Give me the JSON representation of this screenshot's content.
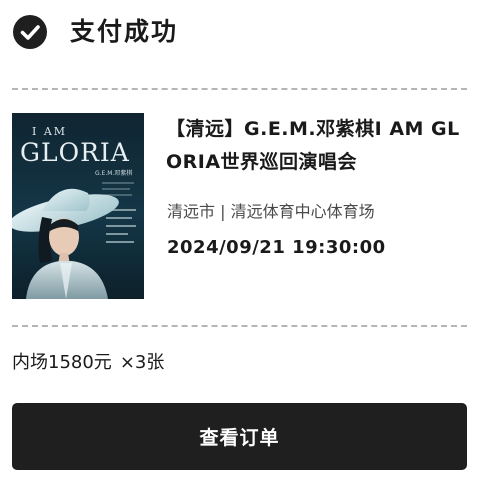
{
  "header": {
    "title": "支付成功",
    "status_icon": "check-circle-icon"
  },
  "event": {
    "poster": {
      "title_line1": "I AM",
      "title_line2": "GLORIA",
      "subtitle": "G.E.M.邓紫棋"
    },
    "title": "【清远】G.E.M.邓紫棋I AM GLORIA世界巡回演唱会",
    "venue": "清远市 | 清远体育中心体育场",
    "datetime": "2024/09/21 19:30:00"
  },
  "ticket": {
    "area_price": "内场1580元",
    "quantity": "×3张"
  },
  "actions": {
    "view_order_label": "查看订单"
  },
  "colors": {
    "primary": "#1f1f1f",
    "divider": "#b5b5b5",
    "text_secondary": "#4a4a4a"
  }
}
